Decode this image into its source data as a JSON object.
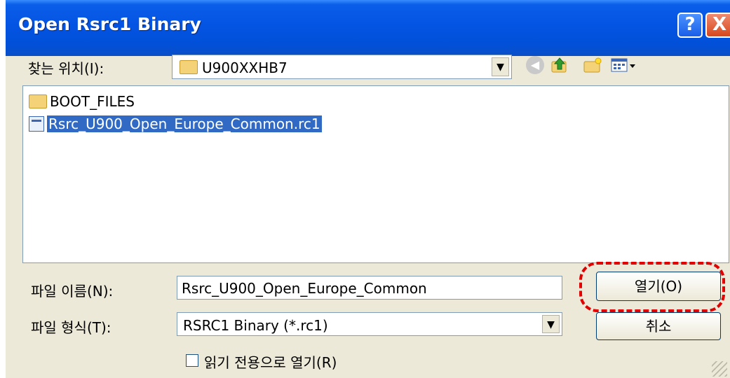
{
  "window": {
    "title": "Open Rsrc1 Binary",
    "help_label": "?",
    "close_label": "X"
  },
  "look_in": {
    "label": "찾는 위치(I):",
    "value": "U900XXHB7",
    "dropdown_icon": "▼"
  },
  "toolbar": {
    "back_icon": "back-arrow-icon",
    "up_icon": "up-folder-icon",
    "new_folder_icon": "new-folder-icon",
    "views_icon": "views-menu-icon"
  },
  "files": [
    {
      "name": "BOOT_FILES",
      "type": "folder",
      "selected": false
    },
    {
      "name": "Rsrc_U900_Open_Europe_Common.rc1",
      "type": "file",
      "selected": true
    }
  ],
  "file_name": {
    "label": "파일 이름(N):",
    "value": "Rsrc_U900_Open_Europe_Common"
  },
  "file_type": {
    "label": "파일 형식(T):",
    "value": "RSRC1 Binary (*.rc1)",
    "dropdown_icon": "▼"
  },
  "buttons": {
    "open": "열기(O)",
    "cancel": "취소"
  },
  "readonly_checkbox": {
    "label": "읽기 전용으로 열기(R)",
    "checked": false
  },
  "colors": {
    "title_bar": "#0454e3",
    "selection": "#316ac5",
    "highlight_annotation": "#e00000"
  }
}
